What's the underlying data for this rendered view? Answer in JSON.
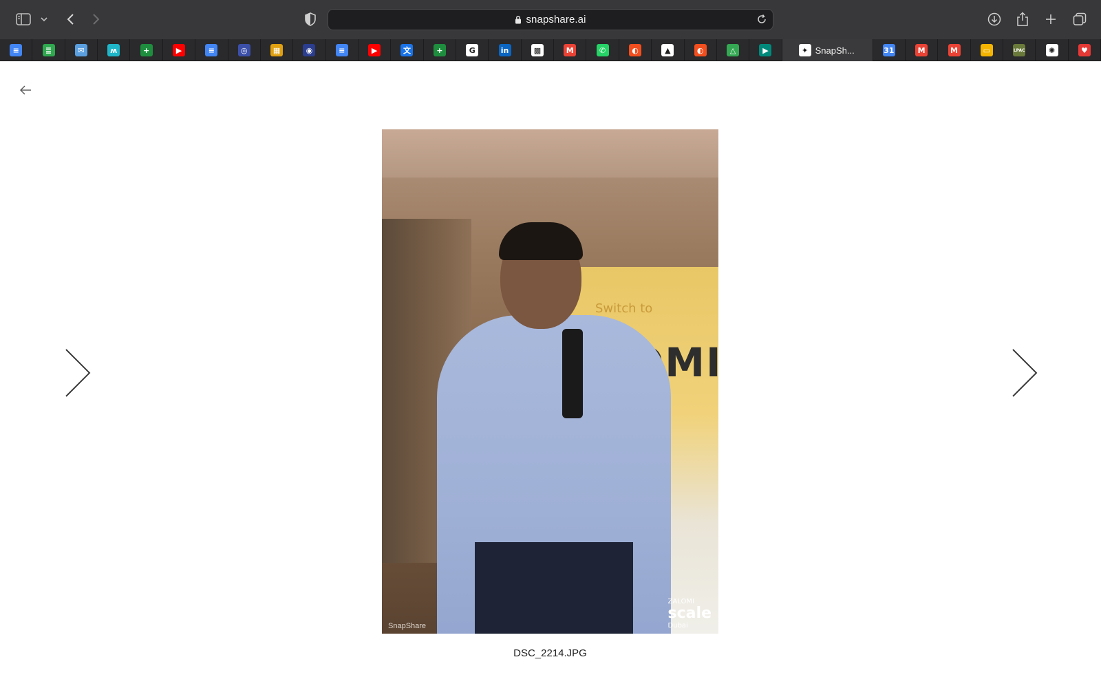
{
  "browser": {
    "url": "snapshare.ai",
    "active_tab_label": "SnapSh...",
    "bookmarks": [
      {
        "icon": "google-docs-icon",
        "color": "#4285f4",
        "glyph": "≡"
      },
      {
        "icon": "stack-icon",
        "color": "#2fa84f",
        "glyph": "≣"
      },
      {
        "icon": "mail-app-icon",
        "color": "#5aa0e0",
        "glyph": "✉"
      },
      {
        "icon": "wave-icon",
        "color": "#1fb6c9",
        "glyph": "ʍ"
      },
      {
        "icon": "google-sheets-icon",
        "color": "#1e8e3e",
        "glyph": "+"
      },
      {
        "icon": "youtube-icon",
        "color": "#ff0000",
        "glyph": "▶"
      },
      {
        "icon": "google-docs-icon",
        "color": "#4285f4",
        "glyph": "≡"
      },
      {
        "icon": "emblem-icon",
        "color": "#3b4fa8",
        "glyph": "◎"
      },
      {
        "icon": "calendar-grid-icon",
        "color": "#e0a010",
        "glyph": "▦"
      },
      {
        "icon": "globe-badge-icon",
        "color": "#2a3d8f",
        "glyph": "◉"
      },
      {
        "icon": "google-docs-icon",
        "color": "#4285f4",
        "glyph": "≡"
      },
      {
        "icon": "youtube-icon",
        "color": "#ff0000",
        "glyph": "▶"
      },
      {
        "icon": "translate-icon",
        "color": "#1a73e8",
        "glyph": "文"
      },
      {
        "icon": "google-sheets-icon",
        "color": "#1e8e3e",
        "glyph": "+"
      },
      {
        "icon": "google-icon",
        "color": "#ffffff",
        "glyph": "G"
      },
      {
        "icon": "linkedin-icon",
        "color": "#0a66c2",
        "glyph": "in"
      },
      {
        "icon": "qr-icon",
        "color": "#ffffff",
        "glyph": "▩"
      },
      {
        "icon": "gmail-icon",
        "color": "#ea4335",
        "glyph": "M"
      },
      {
        "icon": "whatsapp-icon",
        "color": "#25d366",
        "glyph": "✆"
      },
      {
        "icon": "figma-icon",
        "color": "#f24e1e",
        "glyph": "◐"
      },
      {
        "icon": "triangle-app-icon",
        "color": "#ffffff",
        "glyph": "▲"
      },
      {
        "icon": "figma-icon",
        "color": "#f24e1e",
        "glyph": "◐"
      },
      {
        "icon": "google-drive-icon",
        "color": "#34a853",
        "glyph": "△"
      },
      {
        "icon": "google-meet-icon",
        "color": "#00897b",
        "glyph": "▶"
      }
    ],
    "bookmarks_after": [
      {
        "icon": "google-calendar-icon",
        "color": "#4285f4",
        "glyph": "31"
      },
      {
        "icon": "gmail-icon",
        "color": "#ea4335",
        "glyph": "M"
      },
      {
        "icon": "gmail-icon",
        "color": "#ea4335",
        "glyph": "M"
      },
      {
        "icon": "google-slides-icon",
        "color": "#f4b400",
        "glyph": "▭"
      },
      {
        "icon": "lpac-icon",
        "color": "#6a7a3a",
        "glyph": "LPAC"
      },
      {
        "icon": "openai-icon",
        "color": "#ffffff",
        "glyph": "✺"
      },
      {
        "icon": "heart-icon",
        "color": "#e53935",
        "glyph": "♥"
      }
    ]
  },
  "viewer": {
    "filename": "DSC_2214.JPG",
    "photo_watermark": "SnapShare",
    "photo_logo_top": "ZALOMI",
    "photo_logo_main": "scale",
    "photo_logo_city": "Dubai",
    "banner_text": "OMI"
  }
}
